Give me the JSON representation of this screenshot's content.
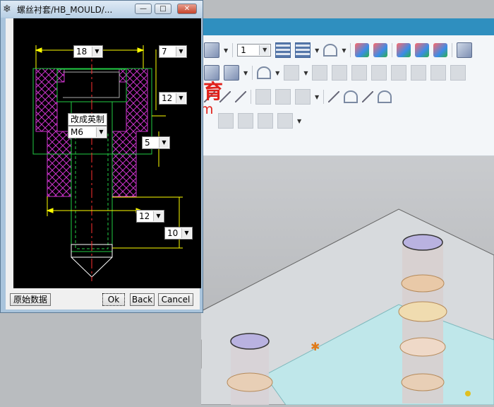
{
  "dialog": {
    "title": "螺丝衬套/HB_MOULD/...",
    "minimize": "—",
    "maximize": "□",
    "close": "✕",
    "buttons": {
      "original_data": "原始数据",
      "ok": "Ok",
      "back": "Back",
      "cancel": "Cancel"
    },
    "fields": {
      "dim_top": "18",
      "dim_right_top": "7",
      "dim_mid": "12",
      "dim_five": "5",
      "dim_twelve": "12",
      "dim_ten": "10",
      "change_label": "改成英制",
      "thread": "M6"
    }
  },
  "toolbar": {
    "layer_value": "1"
  },
  "watermark": {
    "cn": "中磊教育",
    "url": "ugboke.com"
  },
  "colors": {
    "title_strip": "#2f8fbf",
    "drawing_bg": "#000000",
    "dim_yellow": "#ffff00",
    "part_magenta": "#cc33cc",
    "part_green": "#22cc44",
    "axis_red": "#ff3030",
    "watermark_red": "#e0211a"
  }
}
